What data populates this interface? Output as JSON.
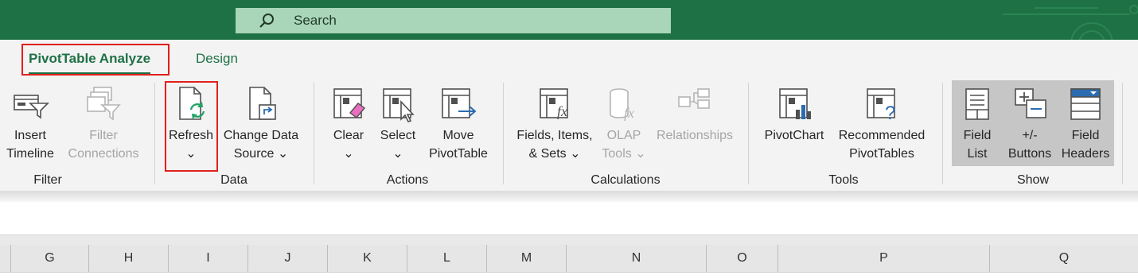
{
  "search": {
    "placeholder": "Search",
    "icon": "search-icon"
  },
  "tabs": [
    {
      "label": "PivotTable Analyze",
      "active": true
    },
    {
      "label": "Design",
      "active": false
    }
  ],
  "ribbon": {
    "groups": {
      "filter": "Filter",
      "data": "Data",
      "actions": "Actions",
      "calculations": "Calculations",
      "tools": "Tools",
      "show": "Show"
    },
    "buttons": {
      "insert_timeline": {
        "line1": "Insert",
        "line2": "Timeline",
        "enabled": true
      },
      "filter_connections": {
        "line1": "Filter",
        "line2": "Connections",
        "enabled": false
      },
      "refresh": {
        "line1": "Refresh",
        "line2": "⌄",
        "enabled": true
      },
      "change_data_source": {
        "line1": "Change Data",
        "line2": "Source ⌄",
        "enabled": true
      },
      "clear": {
        "line1": "Clear",
        "line2": "⌄",
        "enabled": true
      },
      "select": {
        "line1": "Select",
        "line2": "⌄",
        "enabled": true
      },
      "move_pivottable": {
        "line1": "Move",
        "line2": "PivotTable",
        "enabled": true
      },
      "fields_items_sets": {
        "line1": "Fields, Items,",
        "line2": "& Sets ⌄",
        "enabled": true
      },
      "olap_tools": {
        "line1": "OLAP",
        "line2": "Tools ⌄",
        "enabled": false
      },
      "relationships": {
        "line1": "Relationships",
        "line2": "",
        "enabled": false
      },
      "pivotchart": {
        "line1": "PivotChart",
        "line2": "",
        "enabled": true
      },
      "recommended_pivottables": {
        "line1": "Recommended",
        "line2": "PivotTables",
        "enabled": true
      },
      "field_list": {
        "line1": "Field",
        "line2": "List",
        "enabled": true,
        "selected": true
      },
      "plus_minus_buttons": {
        "line1": "+/-",
        "line2": "Buttons",
        "enabled": true,
        "selected": true
      },
      "field_headers": {
        "line1": "Field",
        "line2": "Headers",
        "enabled": true,
        "selected": true
      }
    }
  },
  "columns": [
    "G",
    "H",
    "I",
    "J",
    "K",
    "L",
    "M",
    "N",
    "O",
    "P",
    "Q"
  ],
  "colors": {
    "accent": "#1e7145",
    "highlight": "#e0201b",
    "search_bg": "#a9d5b9"
  }
}
